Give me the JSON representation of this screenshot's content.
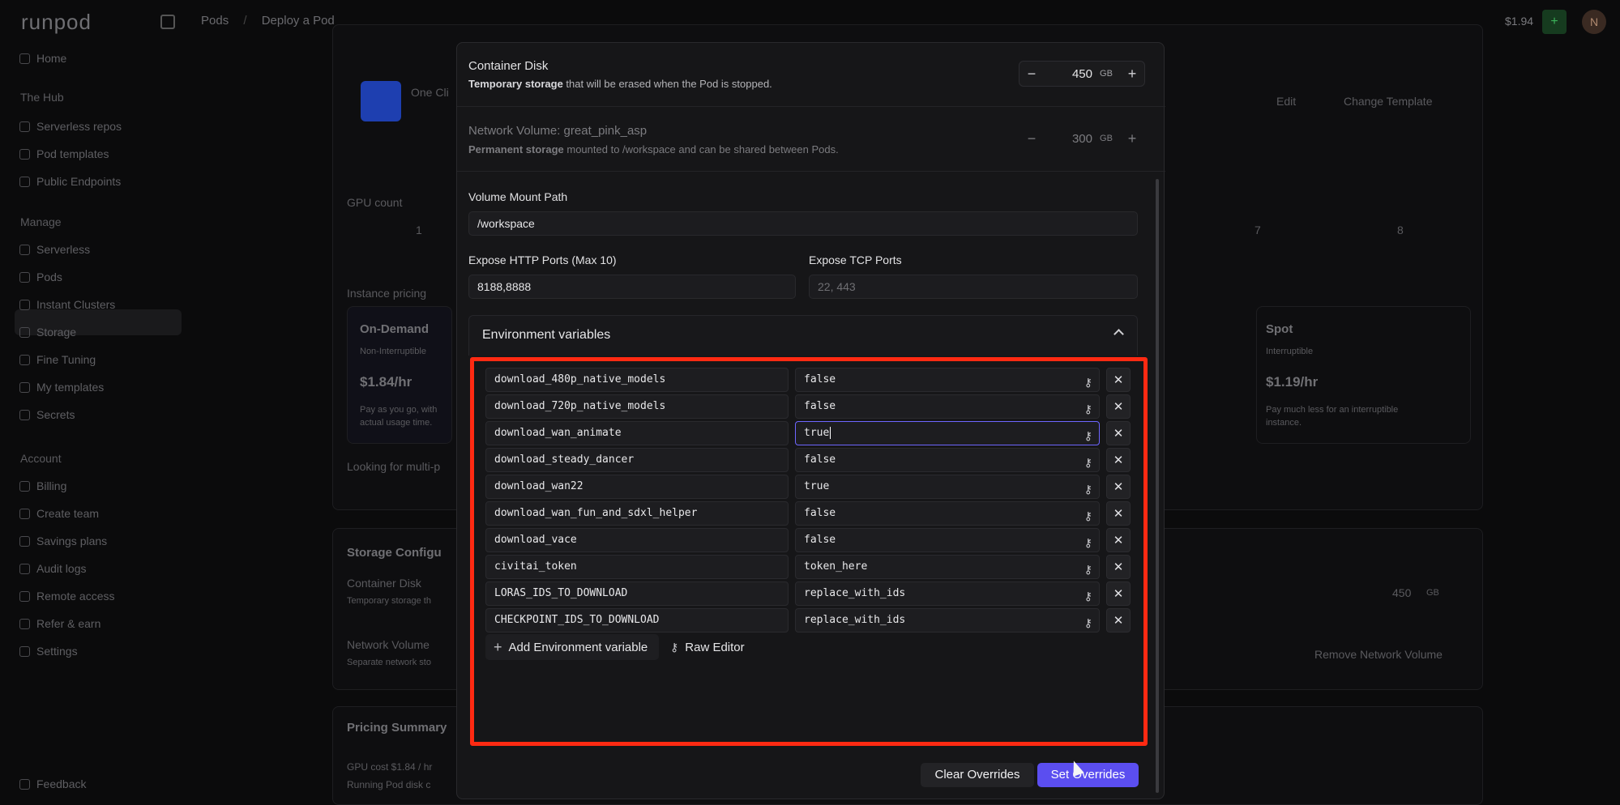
{
  "app": {
    "logo": "runpod",
    "balance": "$1.94"
  },
  "breadcrumb": [
    "Pods",
    "Deploy a Pod"
  ],
  "avatar_initial": "N",
  "sidebar": {
    "items_top": [
      {
        "label": "Home"
      }
    ],
    "hub_heading": "The Hub",
    "hub_items": [
      {
        "label": "Serverless repos"
      },
      {
        "label": "Pod templates"
      },
      {
        "label": "Public Endpoints"
      }
    ],
    "manage_heading": "Manage",
    "manage_items": [
      {
        "label": "Serverless"
      },
      {
        "label": "Pods"
      },
      {
        "label": "Instant Clusters"
      },
      {
        "label": "Storage"
      },
      {
        "label": "Fine Tuning"
      },
      {
        "label": "My templates"
      },
      {
        "label": "Secrets"
      }
    ],
    "account_heading": "Account",
    "account_items": [
      {
        "label": "Billing"
      },
      {
        "label": "Create team"
      },
      {
        "label": "Savings plans"
      },
      {
        "label": "Audit logs"
      },
      {
        "label": "Remote access"
      },
      {
        "label": "Refer & earn"
      },
      {
        "label": "Settings"
      }
    ],
    "feedback": "Feedback"
  },
  "background": {
    "template_name": "One Cli",
    "edit": "Edit",
    "change_template": "Change Template",
    "gpu_count_label": "GPU count",
    "gpu_counts": [
      "1",
      "7",
      "8"
    ],
    "instance_pricing_label": "Instance pricing",
    "on_demand": {
      "title": "On-Demand",
      "sub": "Non-Interruptible",
      "price": "$1.84/hr",
      "desc": "Pay as you go, with",
      "desc2": "actual usage time."
    },
    "spot": {
      "title": "Spot",
      "sub": "Interruptible",
      "price": "$1.19/hr",
      "desc": "Pay much less for an interruptible",
      "desc2": "instance."
    },
    "looking_for": "Looking for multi-p",
    "storage_config": "Storage Configu",
    "container_disk": "Container Disk",
    "temp_storage": "Temporary storage th",
    "network_volume": "Network Volume",
    "separate_network": "Separate network sto",
    "disk_value": "450",
    "disk_unit": "GB",
    "remove_network_volume": "Remove Network Volume",
    "pricing_summary": "Pricing Summary",
    "gpu_cost": "GPU cost $1.84 / hr",
    "running_pod": "Running Pod disk c"
  },
  "modal": {
    "container_disk": {
      "title": "Container Disk",
      "sub_bold": "Temporary storage",
      "sub_rest": " that will be erased when the Pod is stopped.",
      "value": "450",
      "unit": "GB"
    },
    "network_volume": {
      "title": "Network Volume: great_pink_asp",
      "sub_bold": "Permanent storage",
      "sub_rest": " mounted to /workspace and can be shared between Pods.",
      "value": "300",
      "unit": "GB"
    },
    "volume_mount": {
      "label": "Volume Mount Path",
      "value": "/workspace"
    },
    "http_ports": {
      "label": "Expose HTTP Ports (Max 10)",
      "value": "8188,8888"
    },
    "tcp_ports": {
      "label": "Expose TCP Ports",
      "placeholder": "22, 443"
    },
    "env_section": "Environment variables",
    "env_vars": [
      {
        "key": "download_480p_native_models",
        "value": "false"
      },
      {
        "key": "download_720p_native_models",
        "value": "false"
      },
      {
        "key": "download_wan_animate",
        "value": "true"
      },
      {
        "key": "download_steady_dancer",
        "value": "false"
      },
      {
        "key": "download_wan22",
        "value": "true"
      },
      {
        "key": "download_wan_fun_and_sdxl_helper",
        "value": "false"
      },
      {
        "key": "download_vace",
        "value": "false"
      },
      {
        "key": "civitai_token",
        "value": "token_here"
      },
      {
        "key": "LORAS_IDS_TO_DOWNLOAD",
        "value": "replace_with_ids"
      },
      {
        "key": "CHECKPOINT_IDS_TO_DOWNLOAD",
        "value": "replace_with_ids"
      }
    ],
    "add_env_label": "Add Environment variable",
    "raw_editor_label": "Raw Editor",
    "clear_overrides": "Clear Overrides",
    "set_overrides": "Set Overrides"
  },
  "colors": {
    "accent": "#5b4ef0",
    "highlight_border": "#ff2a12"
  }
}
